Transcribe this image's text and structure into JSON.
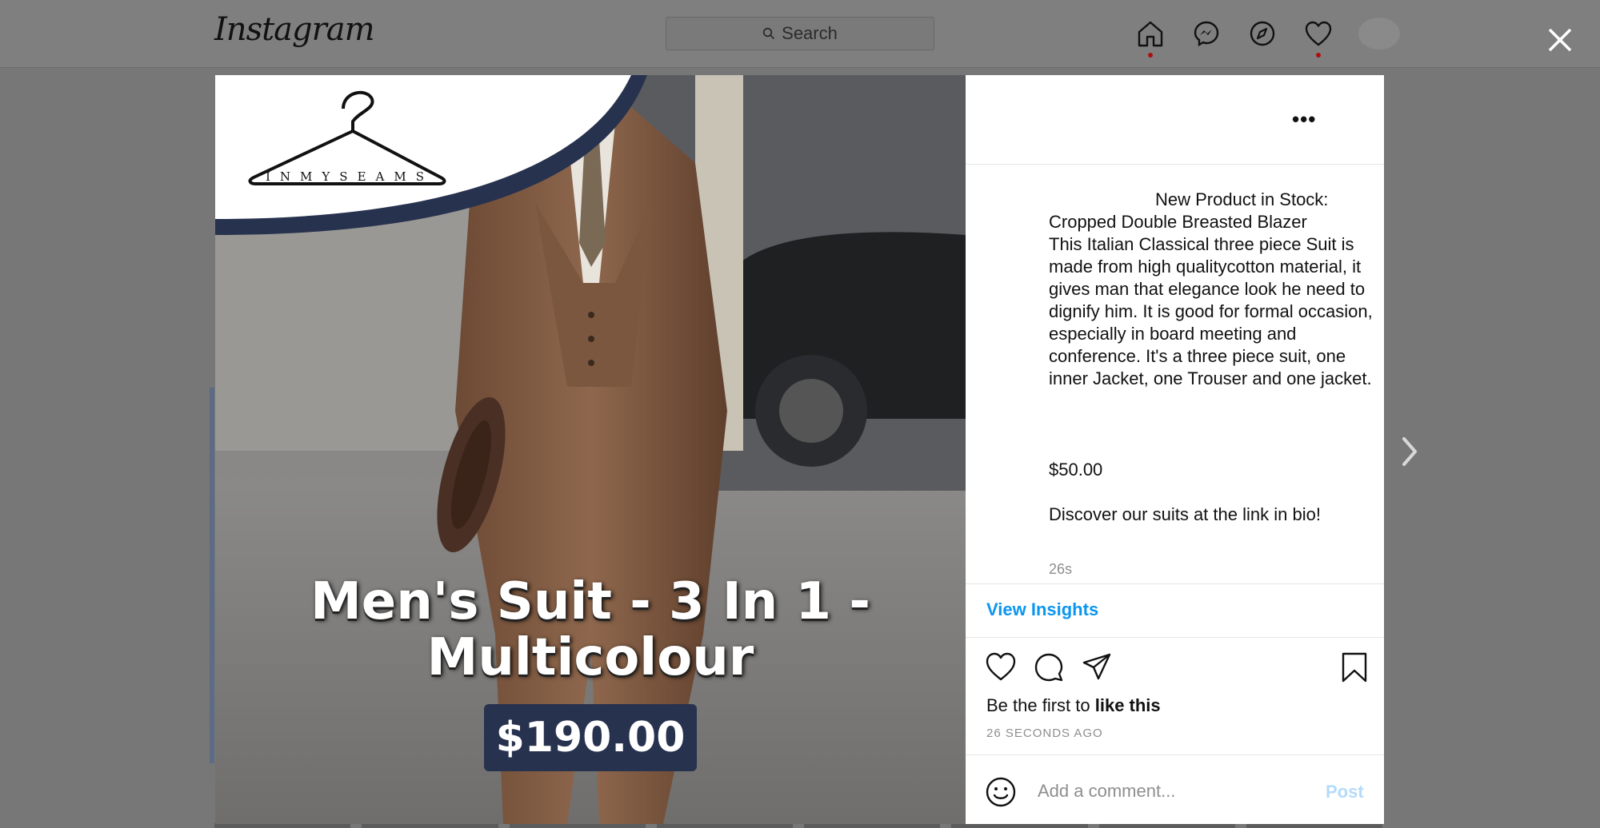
{
  "topbar": {
    "logo": "Instagram",
    "search_placeholder": "Search",
    "nav_icons": [
      "home-icon",
      "messenger-icon",
      "explore-icon",
      "heart-icon",
      "avatar"
    ]
  },
  "modal": {
    "image": {
      "brand": "INMYSEAMS",
      "headline_line1": "Men's Suit - 3 In 1 -",
      "headline_line2": "Multicolour",
      "price": "$190.00"
    },
    "caption": {
      "lines": [
        "New Product in Stock:",
        "Cropped Double Breasted Blazer",
        "This Italian Classical three piece Suit is made from high qualitycotton material, it gives man that elegance look he need to dignify him. It is good for formal occasion, especially in board meeting and conference. It's a three piece suit, one inner Jacket, one Trouser and one jacket."
      ],
      "price": "$50.00",
      "cta": "Discover our suits at the link in bio!",
      "timestamp": "26s"
    },
    "view_insights": "View Insights",
    "likes_prefix": "Be the first to ",
    "likes_action": "like this",
    "time_ago": "26 SECONDS AGO",
    "comment_placeholder": "Add a comment...",
    "post_label": "Post"
  },
  "colors": {
    "link_blue": "#0a95f0",
    "post_disabled": "#b3dbfb",
    "price_box": "#27324f"
  }
}
